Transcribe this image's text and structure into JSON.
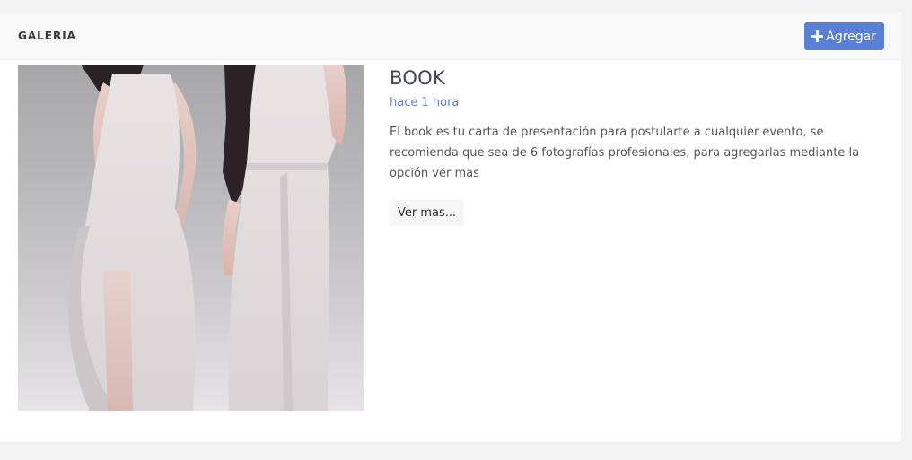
{
  "header": {
    "title": "GALERIA",
    "add_button_label": "Agregar"
  },
  "gallery": {
    "items": [
      {
        "title": "BOOK",
        "time": "hace 1 hora",
        "description": "El book es tu carta de presentación para postularte a cualquier evento, se recomienda que sea de 6 fotografías profesionales, para agregarlas mediante la opción ver mas",
        "more_label": "Ver mas..."
      }
    ]
  },
  "colors": {
    "accent": "#5a7fd6",
    "time_text": "#6b7fd7",
    "title_text": "#3f4658"
  },
  "icons": {
    "add": "plus-icon"
  }
}
